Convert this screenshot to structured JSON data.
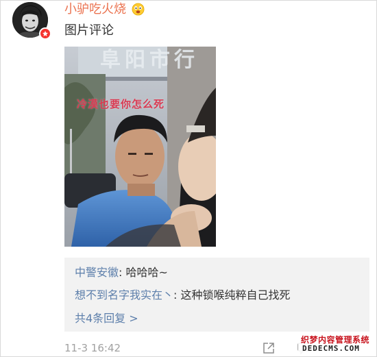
{
  "post": {
    "username": "小驴吃火烧",
    "comment_text": "图片评论",
    "photo_caption": "冷漠也要你怎么死",
    "photo_sign": "阜阳市行"
  },
  "replies": {
    "items": [
      {
        "author": "中警安徽",
        "separator": ": ",
        "text": "哈哈哈~"
      },
      {
        "author": "想不到名字我实在丶",
        "separator": ": ",
        "text": "这种锁喉纯粹自己找死"
      }
    ],
    "more_label": "共4条回复 >"
  },
  "footer": {
    "timestamp": "11-3 16:42"
  },
  "watermark": {
    "line1": "织梦内容管理系统",
    "line2": "DEDECMS.COM"
  },
  "colors": {
    "username": "#eb7350",
    "link": "#5d7fab",
    "reply_bg": "#f2f2f2",
    "timestamp": "#a1a1a1",
    "badge": "#f5342f"
  },
  "icons": {
    "avatar": "avatar-image",
    "vip": "vip-badge-icon",
    "emoji": "emoji-icon",
    "share": "share-icon",
    "comment": "comment-icon"
  }
}
